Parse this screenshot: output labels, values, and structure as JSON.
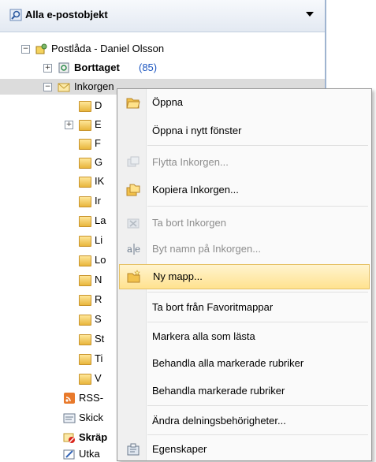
{
  "header": {
    "title": "Alla e-postobjekt"
  },
  "tree": {
    "mailbox": "Postlåda - Daniel Olsson",
    "deleted": {
      "label": "Borttaget",
      "count": "(85)"
    },
    "inbox": "Inkorgen",
    "subfolders": [
      "D",
      "E",
      "F",
      "G",
      "IK",
      "Ir",
      "La",
      "Li",
      "Lo",
      "N",
      "R",
      "S",
      "St",
      "Ti",
      "V"
    ],
    "rss": "RSS-",
    "sent": "Skick",
    "junk": "Skräp",
    "outbox": "Utka"
  },
  "menu": {
    "items": [
      {
        "label": "Öppna",
        "enabled": true,
        "icon": "open-folder-icon"
      },
      {
        "label": "Öppna i nytt fönster",
        "enabled": true,
        "icon": ""
      },
      {
        "label": "Flytta Inkorgen...",
        "enabled": false,
        "icon": "move-folder-icon"
      },
      {
        "label": "Kopiera Inkorgen...",
        "enabled": true,
        "icon": "copy-folder-icon"
      },
      {
        "label": "Ta bort Inkorgen",
        "enabled": false,
        "icon": "delete-folder-icon"
      },
      {
        "label": "Byt namn på Inkorgen...",
        "enabled": false,
        "icon": "rename-icon"
      },
      {
        "label": "Ny mapp...",
        "enabled": true,
        "highlighted": true,
        "icon": "new-folder-icon"
      },
      {
        "label": "Ta bort från Favoritmappar",
        "enabled": true,
        "icon": ""
      },
      {
        "label": "Markera alla som lästa",
        "enabled": true,
        "icon": ""
      },
      {
        "label": "Behandla alla markerade rubriker",
        "enabled": true,
        "icon": ""
      },
      {
        "label": "Behandla markerade rubriker",
        "enabled": true,
        "icon": ""
      },
      {
        "label": "Ändra delningsbehörigheter...",
        "enabled": true,
        "icon": ""
      },
      {
        "label": "Egenskaper",
        "enabled": true,
        "icon": "properties-icon"
      }
    ]
  },
  "colors": {
    "highlight": "#ffe28f",
    "count": "#1b55c0",
    "selection": "#dcdcdc"
  }
}
